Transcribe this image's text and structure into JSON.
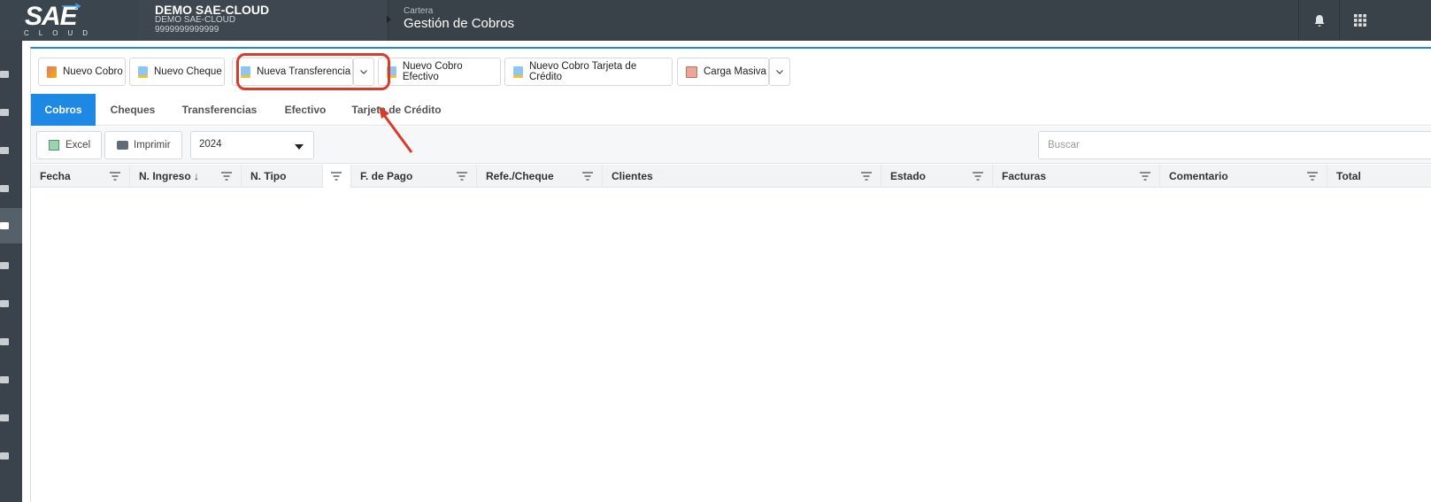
{
  "header": {
    "logo_text": "SAE",
    "logo_subtext": "CLOUD",
    "company_name": "DEMO SAE-CLOUD",
    "company_sub": "DEMO SAE-CLOUD",
    "company_id": "9999999999999",
    "module": "Cartera",
    "page_title": "Gestión de Cobros",
    "icons": [
      "bell-icon",
      "apps-grid-icon"
    ]
  },
  "toolbar": {
    "nuevo_cobro": "Nuevo Cobro",
    "nuevo_cheque": "Nuevo Cheque",
    "nueva_transferencia": "Nueva Transferencia",
    "nuevo_cobro_efectivo": "Nuevo Cobro Efectivo",
    "nuevo_cobro_tarjeta": "Nuevo Cobro Tarjeta de Crédito",
    "carga_masiva": "Carga Masiva"
  },
  "tabs": [
    {
      "label": "Cobros",
      "active": true
    },
    {
      "label": "Cheques",
      "active": false
    },
    {
      "label": "Transferencias",
      "active": false
    },
    {
      "label": "Efectivo",
      "active": false
    },
    {
      "label": "Tarjeta de Crédito",
      "active": false
    }
  ],
  "filters": {
    "excel": "Excel",
    "imprimir": "Imprimir",
    "year": "2024",
    "search_placeholder": "Buscar"
  },
  "grid": {
    "columns": [
      "Fecha",
      "N. Ingreso ↓",
      "N. Tipo",
      "F. de Pago",
      "Refe./Cheque",
      "Clientes",
      "Estado",
      "Facturas",
      "Comentario",
      "Total"
    ],
    "rows": []
  },
  "colors": {
    "accent": "#1e88e5",
    "topbar": "#394249",
    "highlight": "#d93b2b"
  }
}
